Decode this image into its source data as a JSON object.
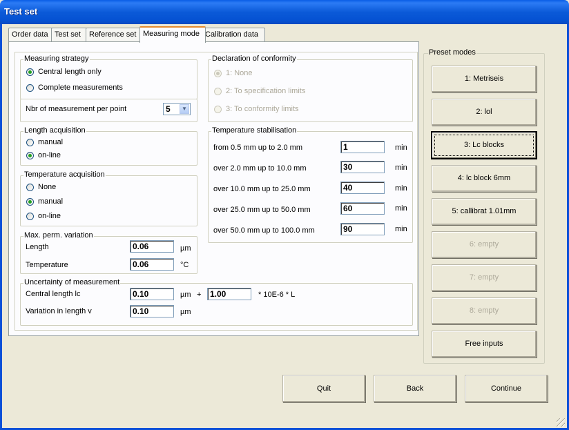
{
  "window": {
    "title": "Test set"
  },
  "tabs": [
    {
      "label": "Order data",
      "active": false
    },
    {
      "label": "Test set",
      "active": false
    },
    {
      "label": "Reference set",
      "active": false
    },
    {
      "label": "Measuring mode",
      "active": true
    },
    {
      "label": "Calibration data",
      "active": false
    }
  ],
  "measuring_strategy": {
    "title": "Measuring strategy",
    "options": [
      "Central length only",
      "Complete measurements"
    ],
    "selected": "Central length only",
    "nbr_label": "Nbr of measurement per point",
    "nbr_value": "5"
  },
  "length_acquisition": {
    "title": "Length acquisition",
    "options": [
      "manual",
      "on-line"
    ],
    "selected": "on-line"
  },
  "temperature_acquisition": {
    "title": "Temperature acquisition",
    "options": [
      "None",
      "manual",
      "on-line"
    ],
    "selected": "manual"
  },
  "max_variation": {
    "title": "Max. perm. variation",
    "length_label": "Length",
    "length_value": "0.06",
    "length_unit": "µm",
    "temp_label": "Temperature",
    "temp_value": "0.06",
    "temp_unit": "°C"
  },
  "declaration": {
    "title": "Declaration of conformity",
    "options": [
      "1: None",
      "2: To specification limits",
      "3: To conformity limits"
    ],
    "selected": "1: None"
  },
  "stabilisation": {
    "title": "Temperature stabilisation",
    "unit": "min",
    "rows": [
      {
        "label": "from 0.5 mm up to 2.0 mm",
        "value": "1"
      },
      {
        "label": "over 2.0 mm up to 10.0 mm",
        "value": "30"
      },
      {
        "label": "over 10.0 mm up to 25.0 mm",
        "value": "40"
      },
      {
        "label": "over 25.0 mm up to 50.0 mm",
        "value": "60"
      },
      {
        "label": "over 50.0 mm up to 100.0 mm",
        "value": "90"
      }
    ]
  },
  "uncertainty": {
    "title": "Uncertainty of measurement",
    "central_label": "Central length lc",
    "central_value": "0.10",
    "central_unit": "µm",
    "plus": "+",
    "factor_value": "1.00",
    "factor_suffix": "* 10E-6 * L",
    "variation_label": "Variation in length v",
    "variation_value": "0.10",
    "variation_unit": "µm"
  },
  "presets": {
    "title": "Preset modes",
    "buttons": [
      {
        "label": "1: Metriseis",
        "enabled": true
      },
      {
        "label": "2: lol",
        "enabled": true
      },
      {
        "label": "3: Lc blocks",
        "enabled": true,
        "focused": true
      },
      {
        "label": "4: lc block 6mm",
        "enabled": true
      },
      {
        "label": "5: callibrat 1.01mm",
        "enabled": true
      },
      {
        "label": "6: empty",
        "enabled": false
      },
      {
        "label": "7: empty",
        "enabled": false
      },
      {
        "label": "8: empty",
        "enabled": false
      },
      {
        "label": "Free inputs",
        "enabled": true
      }
    ]
  },
  "footer": {
    "quit": "Quit",
    "back": "Back",
    "continue": "Continue"
  }
}
